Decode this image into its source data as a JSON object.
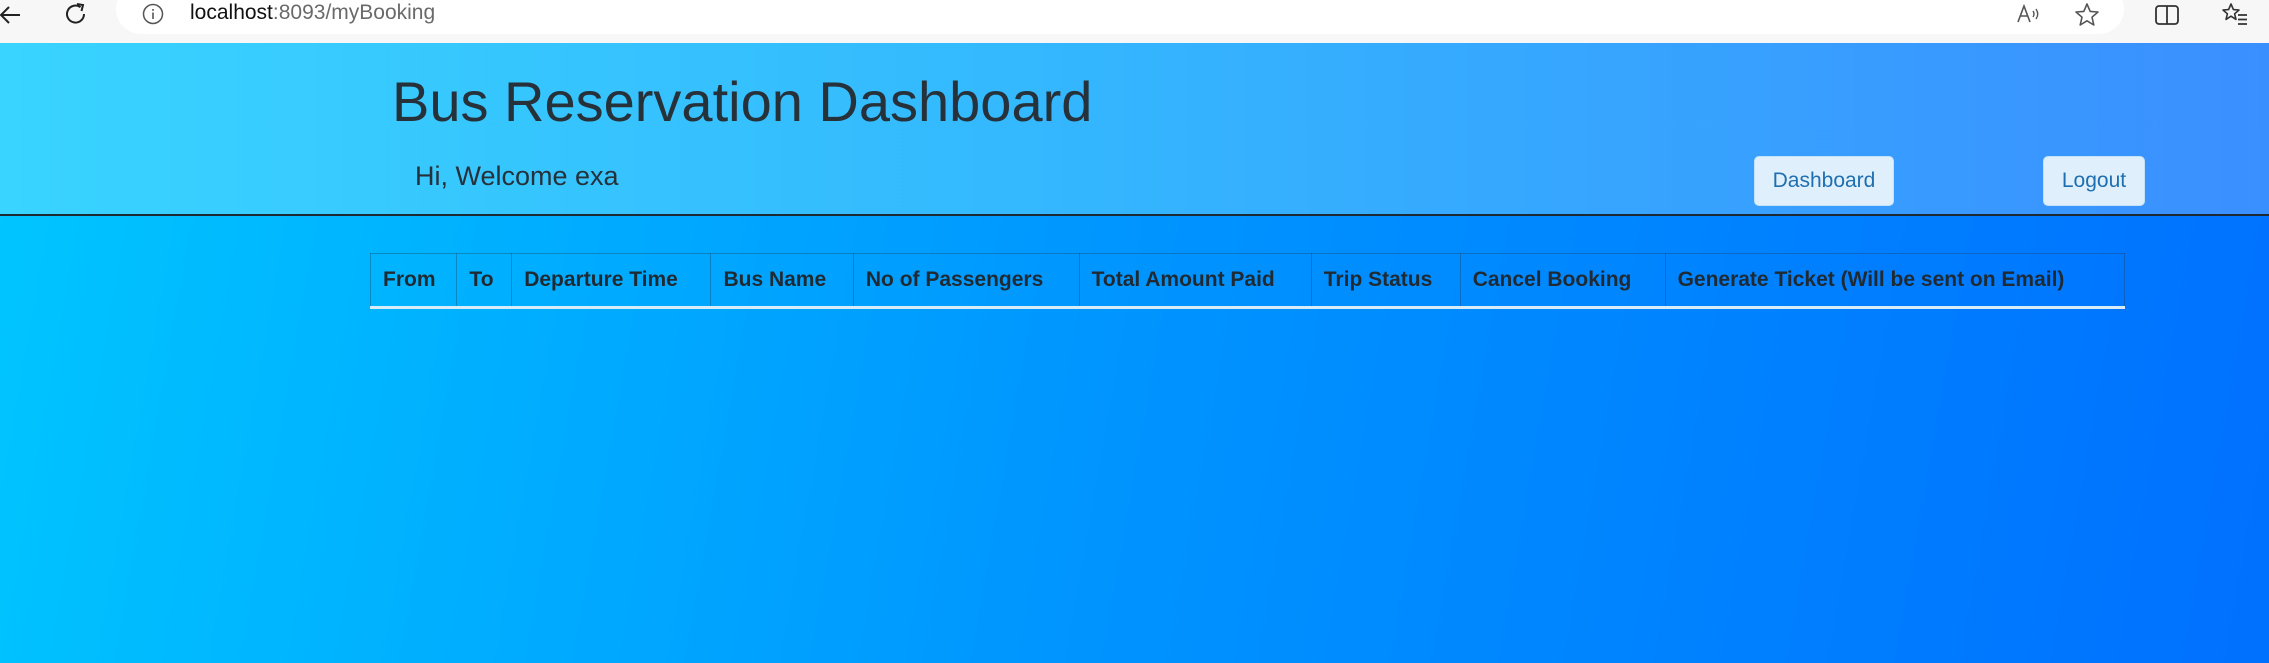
{
  "browser": {
    "url_host": "localhost",
    "url_path": ":8093/myBooking"
  },
  "header": {
    "title": "Bus Reservation Dashboard",
    "welcome": "Hi, Welcome exa",
    "dashboard_label": "Dashboard",
    "logout_label": "Logout"
  },
  "table": {
    "columns": [
      "From",
      "To",
      "Departure Time",
      "Bus Name",
      "No of Passengers",
      "Total Amount Paid",
      "Trip Status",
      "Cancel Booking",
      "Generate Ticket (Will be sent on Email)"
    ],
    "rows": []
  },
  "icons": {
    "back": "arrow-left-icon",
    "reload": "reload-icon",
    "site_info": "info-icon",
    "read_aloud": "read-aloud-icon",
    "favorite": "star-icon",
    "split_screen": "split-screen-icon",
    "favorites": "favorites-icon"
  },
  "colors": {
    "title_text": "#26313a",
    "button_bg": "#dff0fc",
    "button_text": "#1f6fb0",
    "header_gradient_start": "#39d4ff",
    "header_gradient_end": "#3a8fff",
    "page_gradient_start": "#00c6ff",
    "page_gradient_end": "#0070ff"
  }
}
